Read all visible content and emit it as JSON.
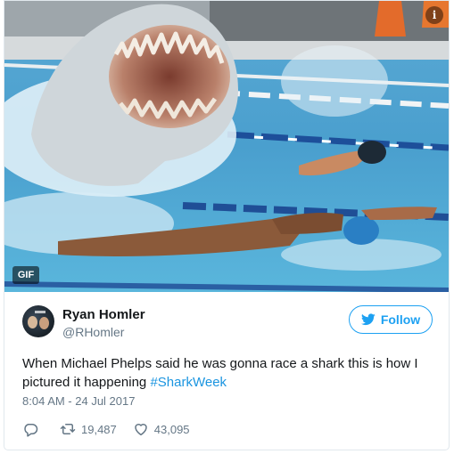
{
  "media": {
    "badge": "GIF",
    "info_icon": "info-icon"
  },
  "author": {
    "name": "Ryan Homler",
    "handle": "@RHomler"
  },
  "follow_button": {
    "label": "Follow",
    "icon": "twitter-bird-icon"
  },
  "tweet": {
    "text_prefix": "When Michael Phelps said he was gonna race a shark this is how I pictured it happening ",
    "hashtag": "#SharkWeek",
    "timestamp": "8:04 AM - 24 Jul 2017"
  },
  "actions": {
    "reply_icon": "reply-icon",
    "retweet_count": "19,487",
    "like_count": "43,095"
  },
  "colors": {
    "accent": "#1da1f2",
    "hashtag": "#1b95e0",
    "muted": "#657786"
  }
}
